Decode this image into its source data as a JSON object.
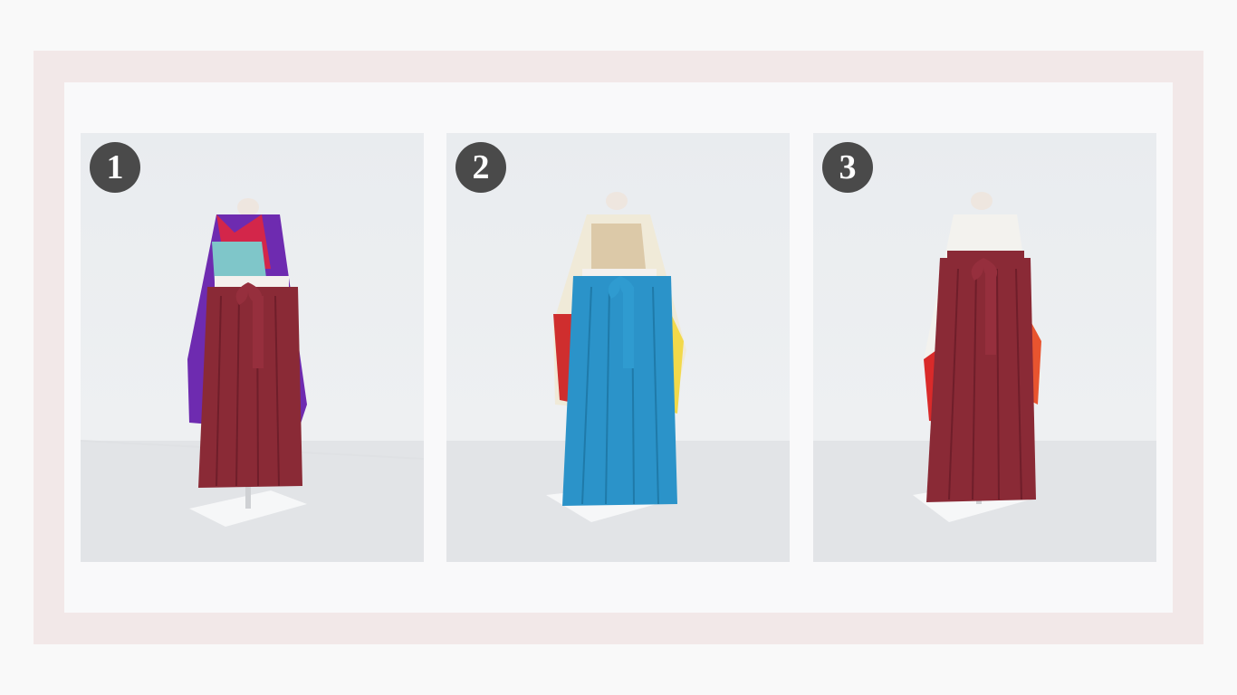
{
  "outfits": [
    {
      "number": "1",
      "kimono": "purple",
      "hakama": "maroon"
    },
    {
      "number": "2",
      "kimono": "cream",
      "hakama": "blue"
    },
    {
      "number": "3",
      "kimono": "white",
      "hakama": "maroon"
    }
  ],
  "colors": {
    "outer_frame": "#f2e8e8",
    "panel": "#f9f9fa",
    "badge": "#4a4a4a",
    "maroon_hakama": "#8a2a36",
    "blue_hakama": "#2b93c9",
    "purple_kimono": "#6e2bb0"
  }
}
